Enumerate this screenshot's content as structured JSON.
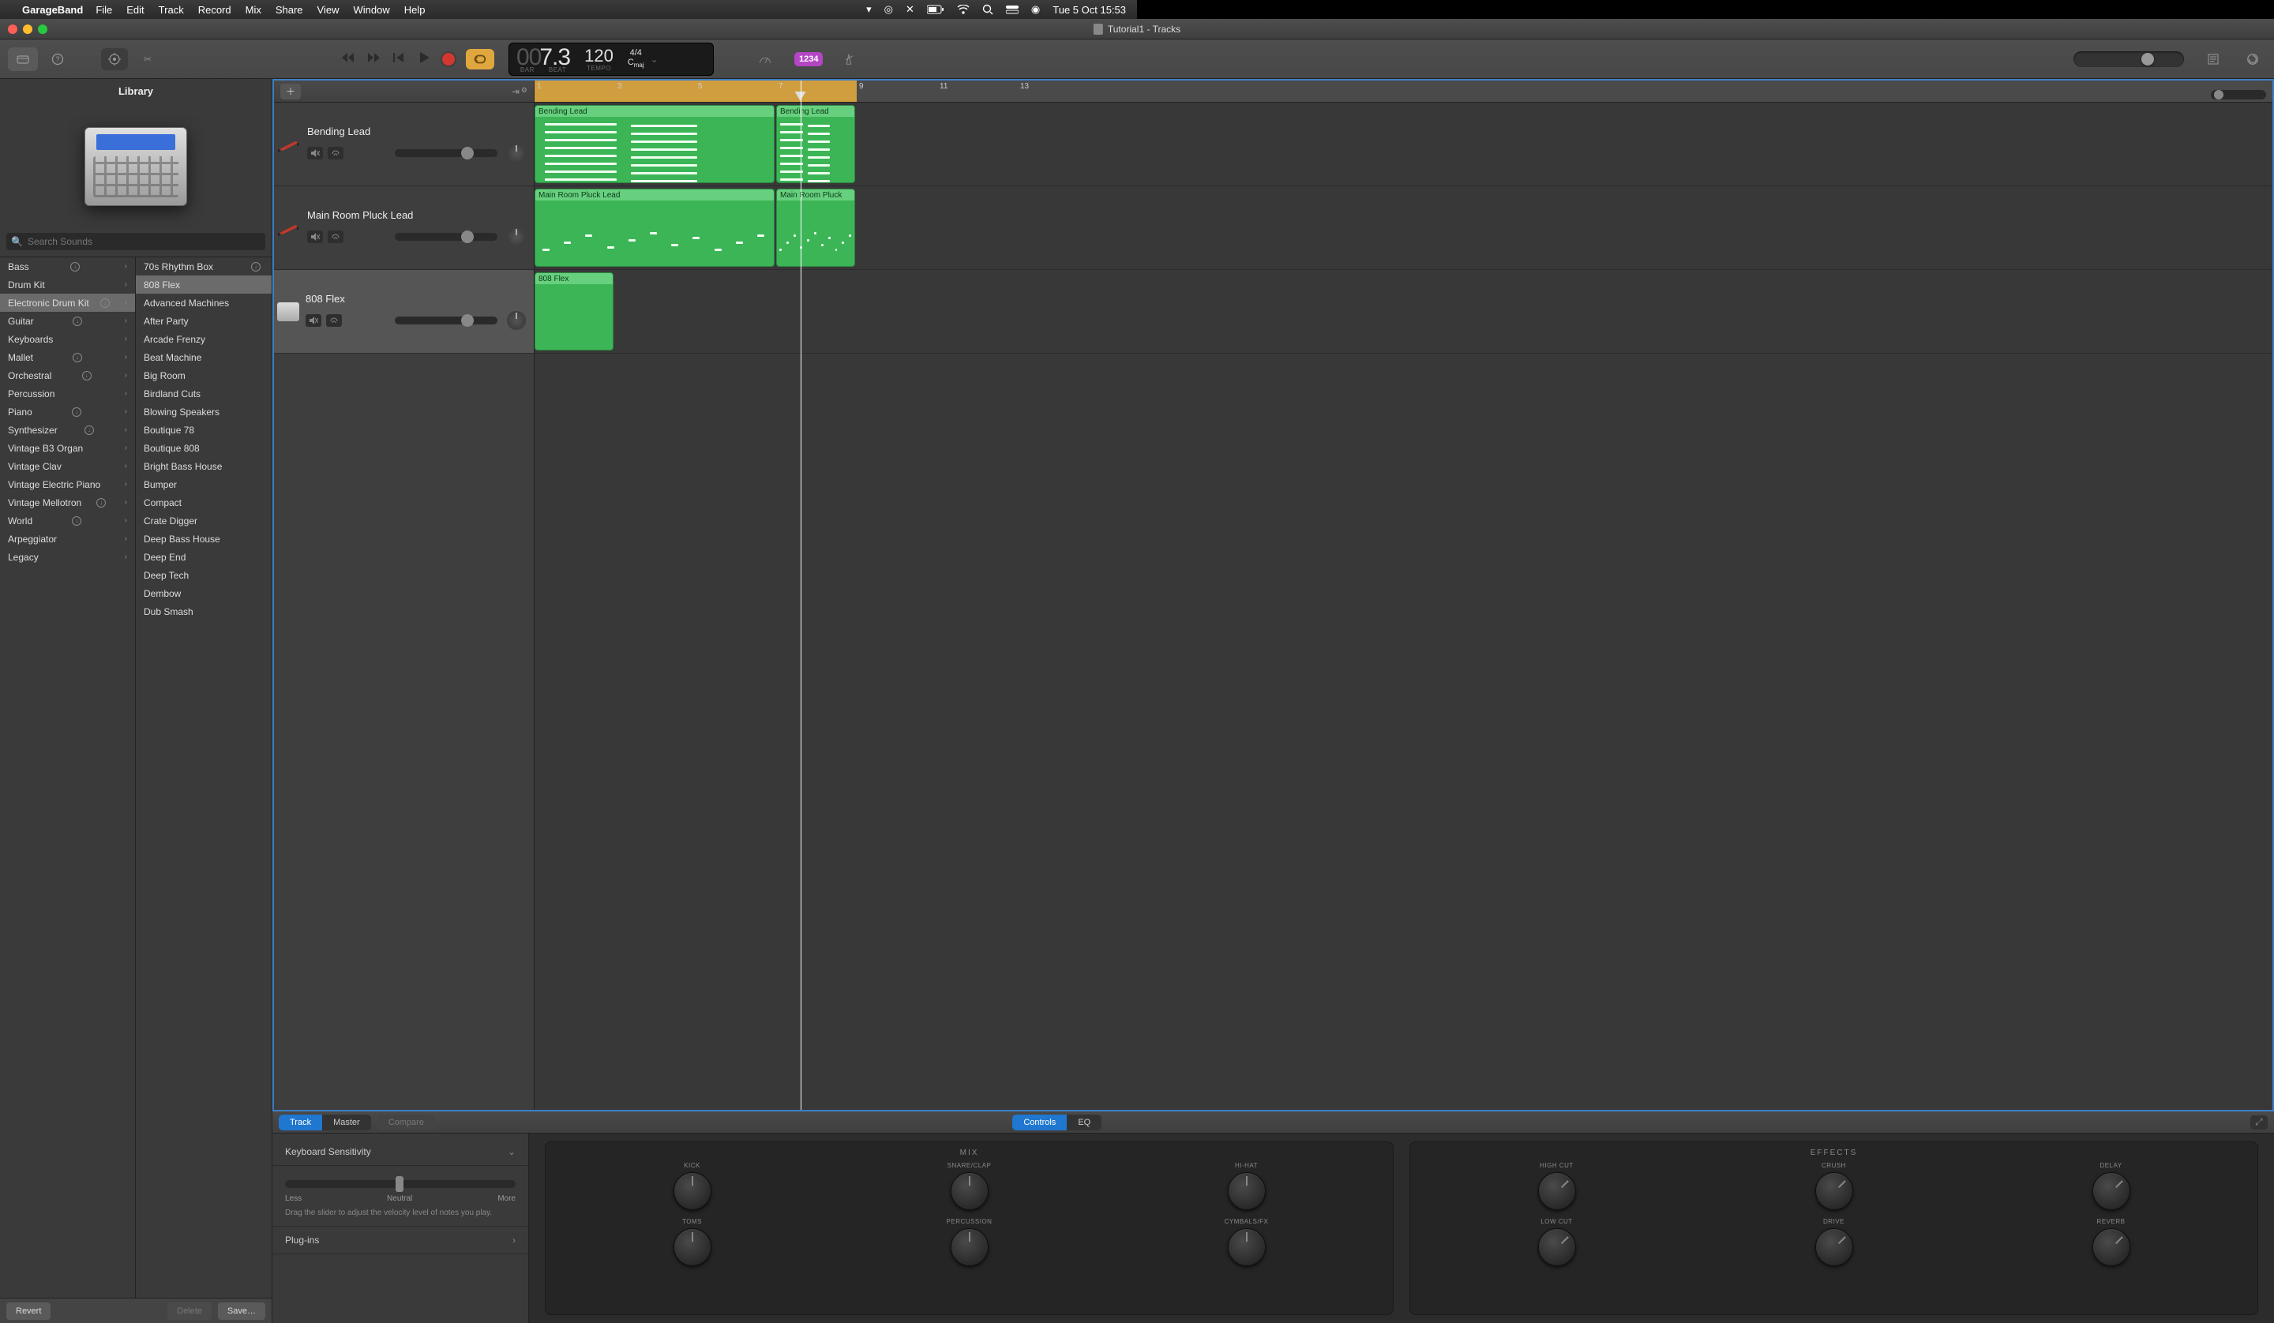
{
  "menu": {
    "app": "GarageBand",
    "items": [
      "File",
      "Edit",
      "Track",
      "Record",
      "Mix",
      "Share",
      "View",
      "Window",
      "Help"
    ],
    "datetime": "Tue 5 Oct  15:53"
  },
  "window": {
    "title": "Tutorial1 - Tracks"
  },
  "transport": {
    "bar": "00",
    "beat": "7.3",
    "bar_label": "BAR",
    "beat_label": "BEAT",
    "tempo": "120",
    "tempo_label": "TEMPO",
    "signature": "4/4",
    "key": "C",
    "key_mode": "maj",
    "count_in": "1234"
  },
  "library": {
    "title": "Library",
    "search_placeholder": "Search Sounds",
    "categories": [
      {
        "name": "Bass",
        "dl": true,
        "chev": true
      },
      {
        "name": "Drum Kit",
        "dl": false,
        "chev": true
      },
      {
        "name": "Electronic Drum Kit",
        "dl": true,
        "chev": true,
        "selected": true
      },
      {
        "name": "Guitar",
        "dl": true,
        "chev": true
      },
      {
        "name": "Keyboards",
        "dl": false,
        "chev": true
      },
      {
        "name": "Mallet",
        "dl": true,
        "chev": true
      },
      {
        "name": "Orchestral",
        "dl": true,
        "chev": true
      },
      {
        "name": "Percussion",
        "dl": false,
        "chev": true
      },
      {
        "name": "Piano",
        "dl": true,
        "chev": true
      },
      {
        "name": "Synthesizer",
        "dl": true,
        "chev": true
      },
      {
        "name": "Vintage B3 Organ",
        "dl": false,
        "chev": true
      },
      {
        "name": "Vintage Clav",
        "dl": false,
        "chev": true
      },
      {
        "name": "Vintage Electric Piano",
        "dl": false,
        "chev": true
      },
      {
        "name": "Vintage Mellotron",
        "dl": true,
        "chev": true
      },
      {
        "name": "World",
        "dl": true,
        "chev": true
      },
      {
        "name": "Arpeggiator",
        "dl": false,
        "chev": true
      },
      {
        "name": "Legacy",
        "dl": false,
        "chev": true
      }
    ],
    "patches": [
      {
        "name": "70s Rhythm Box",
        "dl": true
      },
      {
        "name": "808 Flex",
        "selected": true
      },
      {
        "name": "Advanced Machines"
      },
      {
        "name": "After Party"
      },
      {
        "name": "Arcade Frenzy"
      },
      {
        "name": "Beat Machine"
      },
      {
        "name": "Big Room"
      },
      {
        "name": "Birdland Cuts"
      },
      {
        "name": "Blowing Speakers"
      },
      {
        "name": "Boutique 78"
      },
      {
        "name": "Boutique 808"
      },
      {
        "name": "Bright Bass House"
      },
      {
        "name": "Bumper"
      },
      {
        "name": "Compact"
      },
      {
        "name": "Crate Digger"
      },
      {
        "name": "Deep Bass House"
      },
      {
        "name": "Deep End"
      },
      {
        "name": "Deep Tech"
      },
      {
        "name": "Dembow"
      },
      {
        "name": "Dub Smash"
      }
    ],
    "footer": {
      "revert": "Revert",
      "delete": "Delete",
      "save": "Save…"
    }
  },
  "tracks": [
    {
      "name": "Bending Lead",
      "type": "keyboard",
      "regions": [
        {
          "label": "Bending Lead",
          "start": 1,
          "end": 7
        },
        {
          "label": "Bending Lead",
          "start": 7,
          "end": 9
        }
      ]
    },
    {
      "name": "Main Room Pluck Lead",
      "type": "keyboard",
      "regions": [
        {
          "label": "Main Room Pluck Lead",
          "start": 1,
          "end": 7
        },
        {
          "label": "Main Room Pluck",
          "start": 7,
          "end": 9
        }
      ]
    },
    {
      "name": "808 Flex",
      "type": "drum",
      "selected": true,
      "regions": [
        {
          "label": "808 Flex",
          "start": 1,
          "end": 3
        }
      ]
    }
  ],
  "ruler": {
    "bars": [
      1,
      3,
      5,
      7,
      9,
      11,
      13
    ],
    "cycle_start": 1,
    "cycle_end": 9,
    "playhead_bar": 7.6
  },
  "smart": {
    "tabs": {
      "track": "Track",
      "master": "Master",
      "compare": "Compare",
      "controls": "Controls",
      "eq": "EQ"
    },
    "sensitivity": {
      "title": "Keyboard Sensitivity",
      "less": "Less",
      "neutral": "Neutral",
      "more": "More",
      "hint": "Drag the slider to adjust the velocity level of notes you play."
    },
    "plugins": "Plug-ins",
    "mix": {
      "title": "MIX",
      "knobs": [
        "KICK",
        "SNARE/CLAP",
        "HI-HAT",
        "TOMS",
        "PERCUSSION",
        "CYMBALS/FX"
      ]
    },
    "effects": {
      "title": "EFFECTS",
      "knobs": [
        "HIGH CUT",
        "CRUSH",
        "DELAY",
        "LOW CUT",
        "DRIVE",
        "REVERB"
      ]
    }
  }
}
